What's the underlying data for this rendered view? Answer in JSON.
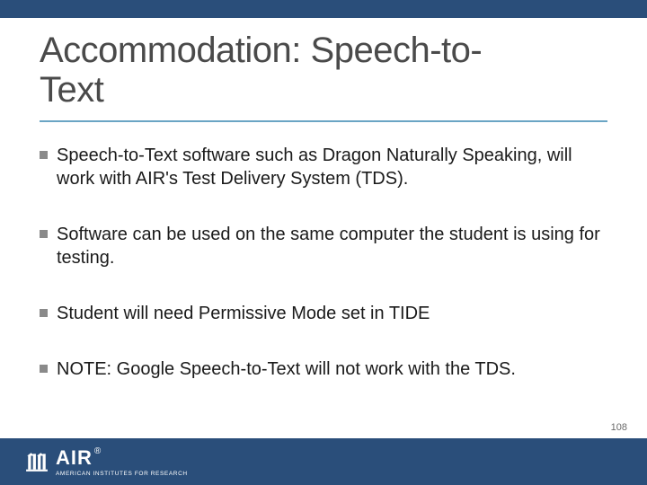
{
  "title_line1": "Accommodation: Speech-to-",
  "title_line2": "Text",
  "bullets": [
    "Speech-to-Text software such as Dragon Naturally Speaking, will work with AIR's Test Delivery System (TDS).",
    "Software can be used on the same computer the student is using for testing.",
    " Student will need Permissive Mode set in TIDE",
    "NOTE: Google Speech-to-Text will not work with the TDS."
  ],
  "footer": {
    "logo_text": "AIR",
    "logo_reg": "®",
    "logo_sub": "AMERICAN INSTITUTES FOR RESEARCH"
  },
  "page_number": "108"
}
